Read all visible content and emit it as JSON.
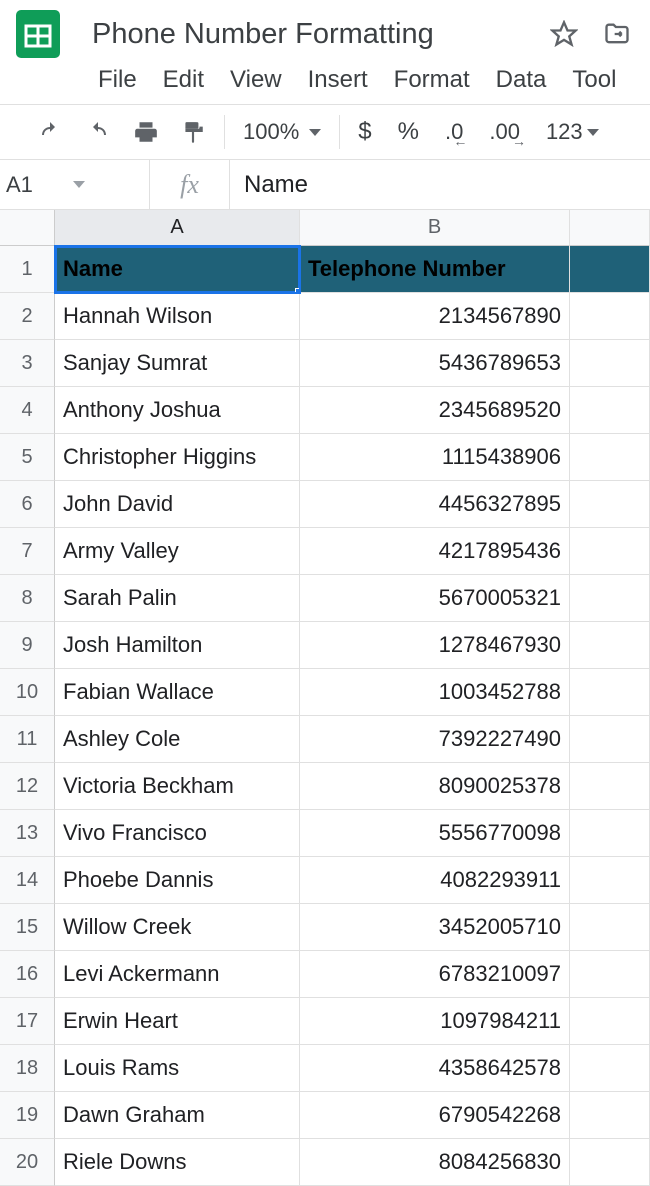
{
  "doc": {
    "title": "Phone Number Formatting"
  },
  "menu": {
    "file": "File",
    "edit": "Edit",
    "view": "View",
    "insert": "Insert",
    "format": "Format",
    "data": "Data",
    "tool": "Tool"
  },
  "toolbar": {
    "zoom": "100%",
    "currency": "$",
    "percent": "%",
    "dec_decrease": ".0",
    "dec_increase": ".00",
    "numfmt": "123"
  },
  "namebox": {
    "ref": "A1"
  },
  "formula": {
    "fx": "fx",
    "value": "Name"
  },
  "columns": {
    "A": "A",
    "B": "B"
  },
  "headers": {
    "name": "Name",
    "tel": "Telephone Number"
  },
  "rows": [
    {
      "n": "1"
    },
    {
      "n": "2",
      "name": "Hannah Wilson",
      "tel": "2134567890"
    },
    {
      "n": "3",
      "name": "Sanjay Sumrat",
      "tel": "5436789653"
    },
    {
      "n": "4",
      "name": "Anthony Joshua",
      "tel": "2345689520"
    },
    {
      "n": "5",
      "name": "Christopher Higgins",
      "tel": "1115438906"
    },
    {
      "n": "6",
      "name": "John David",
      "tel": "4456327895"
    },
    {
      "n": "7",
      "name": "Army Valley",
      "tel": "4217895436"
    },
    {
      "n": "8",
      "name": "Sarah Palin",
      "tel": "5670005321"
    },
    {
      "n": "9",
      "name": "Josh Hamilton",
      "tel": "1278467930"
    },
    {
      "n": "10",
      "name": "Fabian Wallace",
      "tel": "1003452788"
    },
    {
      "n": "11",
      "name": "Ashley Cole",
      "tel": "7392227490"
    },
    {
      "n": "12",
      "name": "Victoria Beckham",
      "tel": "8090025378"
    },
    {
      "n": "13",
      "name": "Vivo Francisco",
      "tel": "5556770098"
    },
    {
      "n": "14",
      "name": "Phoebe Dannis",
      "tel": "4082293911"
    },
    {
      "n": "15",
      "name": "Willow Creek",
      "tel": "3452005710"
    },
    {
      "n": "16",
      "name": "Levi Ackermann",
      "tel": "6783210097"
    },
    {
      "n": "17",
      "name": "Erwin Heart",
      "tel": "1097984211"
    },
    {
      "n": "18",
      "name": "Louis Rams",
      "tel": "4358642578"
    },
    {
      "n": "19",
      "name": "Dawn Graham",
      "tel": "6790542268"
    },
    {
      "n": "20",
      "name": "Riele Downs",
      "tel": "8084256830"
    }
  ]
}
